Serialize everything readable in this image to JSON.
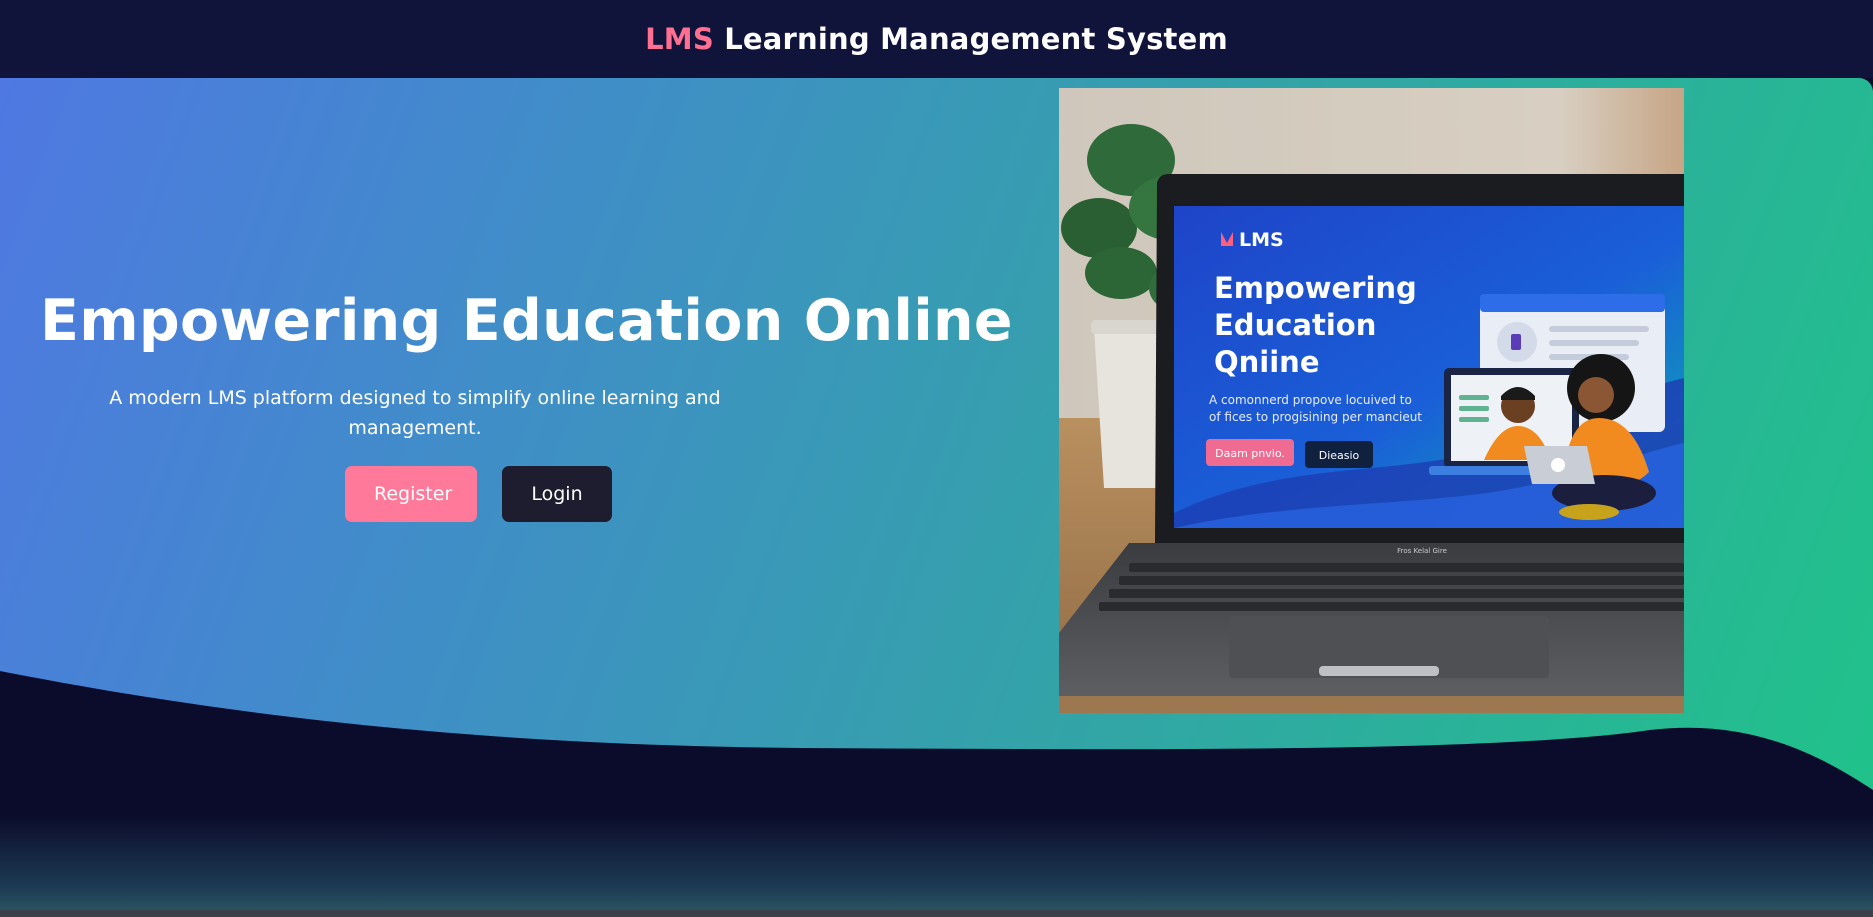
{
  "header": {
    "brand_accent": "LMS",
    "brand_rest": " Learning Management System"
  },
  "hero": {
    "title": "Empowering Education Online",
    "subtitle": "A modern LMS platform designed to simplify online learning and management.",
    "register_label": "Register",
    "login_label": "Login"
  },
  "hero_image": {
    "screen_logo": "LMS",
    "screen_title_lines": [
      "Empowering",
      "Education",
      "Qniine"
    ],
    "screen_text_lines": [
      "A comonnerd propove locuived to",
      "of fices to progisining per mancieut"
    ],
    "screen_button_primary": "Daam pnvio.",
    "screen_button_secondary": "Dieasio",
    "laptop_label": "Fros Kelal Gire"
  },
  "colors": {
    "header_bg": "#10143a",
    "accent_pink": "#ff6f91",
    "register_bg": "#ff7a9a",
    "login_bg": "#1e1c2f",
    "gradient_start": "#4f78e2",
    "gradient_end": "#20c28a",
    "dark_navy": "#0b0c2c"
  }
}
